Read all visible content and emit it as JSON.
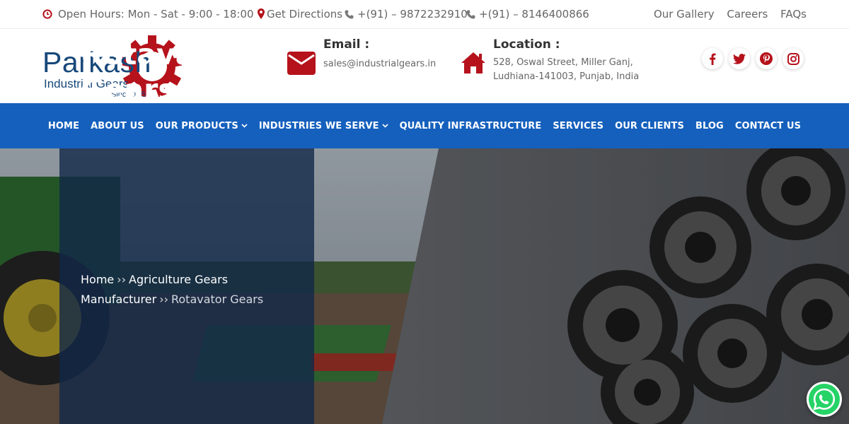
{
  "topbar": {
    "hours": "Open Hours: Mon - Sat - 9:00 - 18:00",
    "directions": "Get Directions",
    "phone1": "+(91) – 9872232910",
    "phone2": "+(91) – 8146400866",
    "links": [
      "Our Gallery",
      "Careers",
      "FAQs"
    ]
  },
  "logo": {
    "title": "Parkash",
    "subtitle": "Industrial Gears",
    "since": "Since 1952"
  },
  "contact": {
    "email_title": "Email :",
    "email": "sales@industrialgears.in",
    "location_title": "Location :",
    "address_line1": "528, Oswal Street, Miller Ganj,",
    "address_line2": "Ludhiana-141003, Punjab, India"
  },
  "social_icons": [
    "facebook-icon",
    "twitter-icon",
    "pinterest-icon",
    "instagram-icon"
  ],
  "nav": {
    "items": [
      "HOME",
      "ABOUT US",
      "OUR PRODUCTS",
      "INDUSTRIES WE SERVE",
      "QUALITY INFRASTRUCTURE",
      "SERVICES",
      "OUR CLIENTS",
      "BLOG",
      "CONTACT US"
    ]
  },
  "hero": {
    "title": "Rotavator Gears",
    "breadcrumb": [
      "Home",
      "Agriculture Gears Manufacturer",
      "Rotavator Gears"
    ],
    "separator": "››"
  },
  "colors": {
    "brand_red": "#b5121b",
    "brand_blue": "#1560bd",
    "logo_blue": "#17487a",
    "whatsapp_green": "#25d366"
  }
}
